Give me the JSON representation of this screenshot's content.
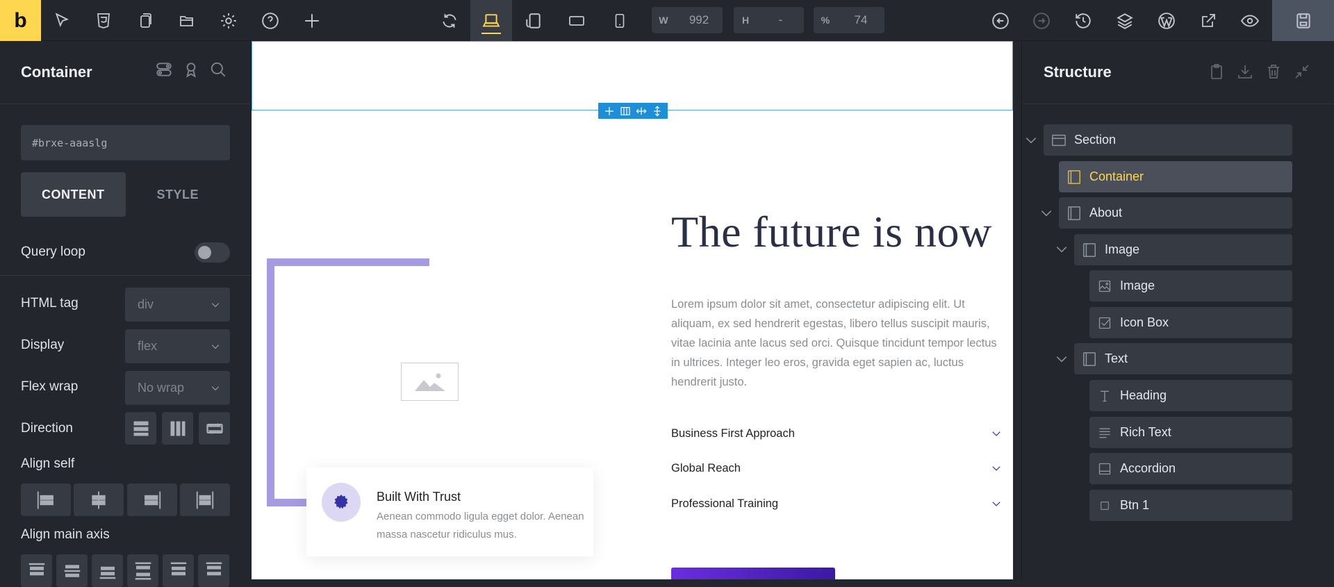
{
  "topbar": {
    "logo": "b",
    "width_label": "W",
    "width_value": "992",
    "height_label": "H",
    "height_value": "-",
    "zoom_label": "%",
    "zoom_value": "74"
  },
  "left_panel": {
    "title": "Container",
    "element_id": "#brxe-aaaslg",
    "tabs": [
      "CONTENT",
      "STYLE"
    ],
    "query_loop_label": "Query loop",
    "html_tag": {
      "label": "HTML tag",
      "value": "div"
    },
    "display": {
      "label": "Display",
      "value": "flex"
    },
    "flex_wrap": {
      "label": "Flex wrap",
      "value": "No wrap"
    },
    "direction_label": "Direction",
    "align_self_label": "Align self",
    "align_main_axis_label": "Align main axis"
  },
  "canvas": {
    "heading": "The future is now",
    "paragraph": "Lorem ipsum dolor sit amet, consectetur adipiscing elit. Ut aliquam, ex sed hendrerit egestas, libero tellus suscipit mauris, vitae lacinia ante lacus sed orci. Quisque tincidunt tempor lectus in ultrices. Integer leo eros, gravida eget sapien ac, luctus hendrerit justo.",
    "accordion": [
      "Business First Approach",
      "Global Reach",
      "Professional Training"
    ],
    "trust_title": "Built With Trust",
    "trust_desc": "Aenean commodo ligula egget dolor. Aenean massa nascetur ridiculus mus.",
    "accent_color": "#3433a5",
    "frame_color": "#a49be0"
  },
  "structure": {
    "title": "Structure",
    "items": [
      {
        "name": "Section",
        "icon": "section-icon"
      },
      {
        "name": "Container",
        "icon": "container-icon"
      },
      {
        "name": "About",
        "icon": "container-icon"
      },
      {
        "name": "Image",
        "icon": "container-icon"
      },
      {
        "name": "Image",
        "icon": "image-icon"
      },
      {
        "name": "Icon Box",
        "icon": "checkbox-icon"
      },
      {
        "name": "Text",
        "icon": "container-icon"
      },
      {
        "name": "Heading",
        "icon": "heading-icon"
      },
      {
        "name": "Rich Text",
        "icon": "text-lines-icon"
      },
      {
        "name": "Accordion",
        "icon": "accordion-icon"
      },
      {
        "name": "Btn 1",
        "icon": "square-icon"
      }
    ]
  },
  "colors": {
    "brand": "#ffd64f",
    "panel_bg": "#23262c",
    "selection": "#1e8fd6"
  }
}
